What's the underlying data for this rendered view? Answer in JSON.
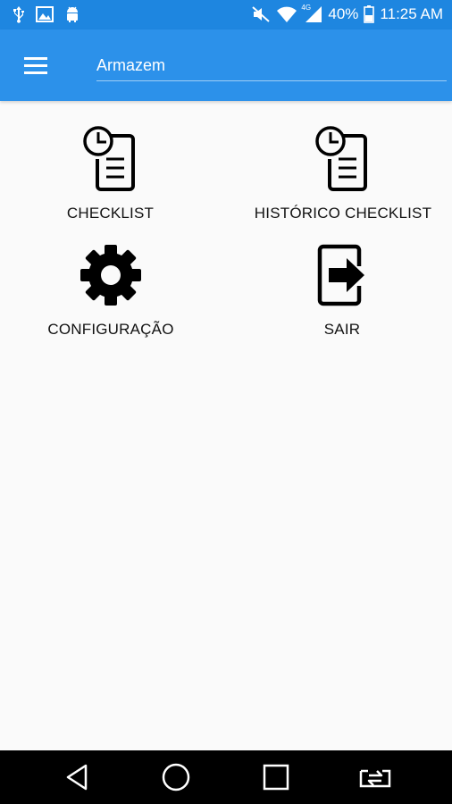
{
  "status_bar": {
    "icons_left": [
      "usb-icon",
      "image-icon",
      "android-icon"
    ],
    "icons_right": [
      "mute-icon",
      "wifi-icon",
      "signal-4g-icon",
      "battery-icon"
    ],
    "network_label": "4G",
    "battery": "40%",
    "time": "11:25 AM"
  },
  "app_bar": {
    "title_value": "Armazem",
    "menu_icon": "hamburger-menu-icon",
    "color": "#2c91ea"
  },
  "tiles": [
    {
      "label": "CHECKLIST",
      "icon": "checklist-clock-icon"
    },
    {
      "label": "HISTÓRICO CHECKLIST",
      "icon": "checklist-history-icon"
    },
    {
      "label": "CONFIGURAÇÃO",
      "icon": "gear-icon"
    },
    {
      "label": "SAIR",
      "icon": "exit-icon"
    }
  ],
  "nav_bar": {
    "buttons": [
      "back-icon",
      "home-icon",
      "recents-icon",
      "switch-app-icon"
    ]
  }
}
